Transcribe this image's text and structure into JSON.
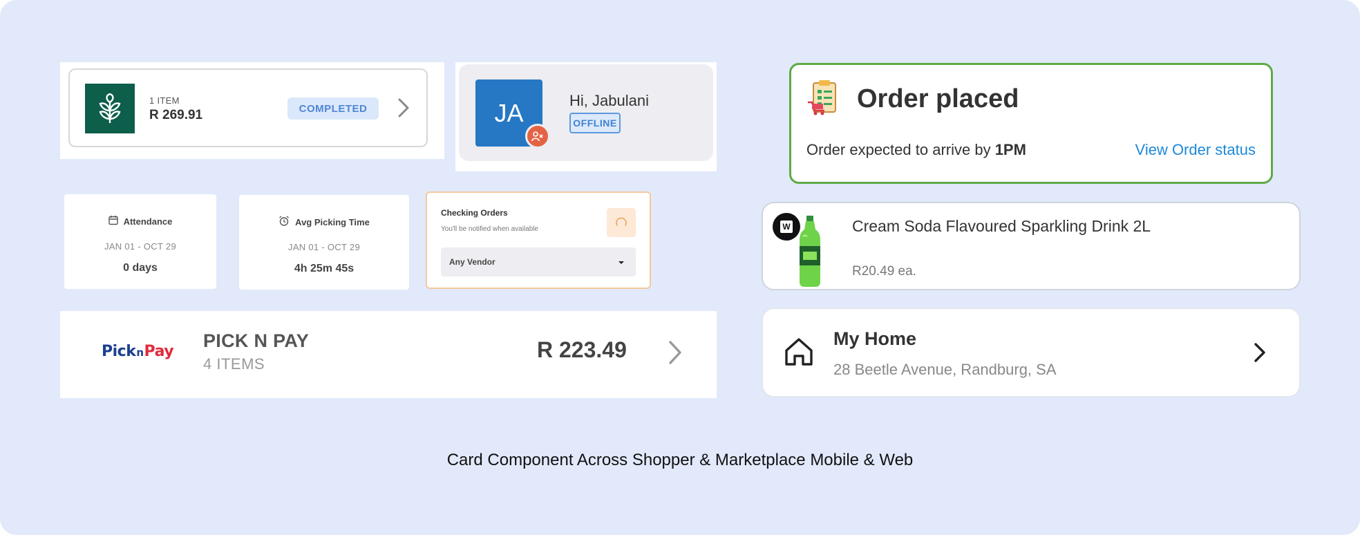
{
  "order_card": {
    "item_count": "1 ITEM",
    "price": "R 269.91",
    "status": "COMPLETED",
    "logo_icon": "leaf-plant-icon",
    "logo_color": "#0d5e4a"
  },
  "user_card": {
    "initials": "JA",
    "greeting": "Hi, Jabulani",
    "status": "OFFLINE",
    "avatar_color": "#2678c4",
    "offline_icon": "user-x-icon"
  },
  "order_placed_card": {
    "title": "Order placed",
    "subtitle_prefix": "Order expected to arrive by ",
    "arrival_time": "1PM",
    "link": "View Order status",
    "icon": "clipboard-checklist-icon",
    "border_color": "#5daa46"
  },
  "attendance_card": {
    "title": "Attendance",
    "range": "JAN 01 - OCT 29",
    "value": "0 days",
    "icon": "calendar-icon"
  },
  "picking_card": {
    "title": "Avg Picking Time",
    "range": "JAN 01 - OCT 29",
    "value": "4h 25m 45s",
    "icon": "alarm-clock-icon"
  },
  "checking_card": {
    "title": "Checking Orders",
    "subtitle": "You'll be notified when available",
    "vendor_select": "Any Vendor",
    "loader_icon": "spinner-icon"
  },
  "product_card": {
    "name": "Cream Soda Flavoured Sparkling Drink 2L",
    "price": "R20.49 ea.",
    "vendor_icon": "woolworths-w-icon",
    "vendor_letter": "W",
    "product_icon": "soda-bottle-icon"
  },
  "store_card": {
    "logo_text_1": "Pick",
    "logo_text_2": "n",
    "logo_text_3": "Pay",
    "store": "PICK N PAY",
    "items": "4 ITEMS",
    "total": "R 223.49"
  },
  "address_card": {
    "title": "My Home",
    "address": "28 Beetle Avenue, Randburg, SA",
    "icon": "home-icon"
  },
  "caption": "Card Component Across Shopper & Marketplace Mobile & Web"
}
